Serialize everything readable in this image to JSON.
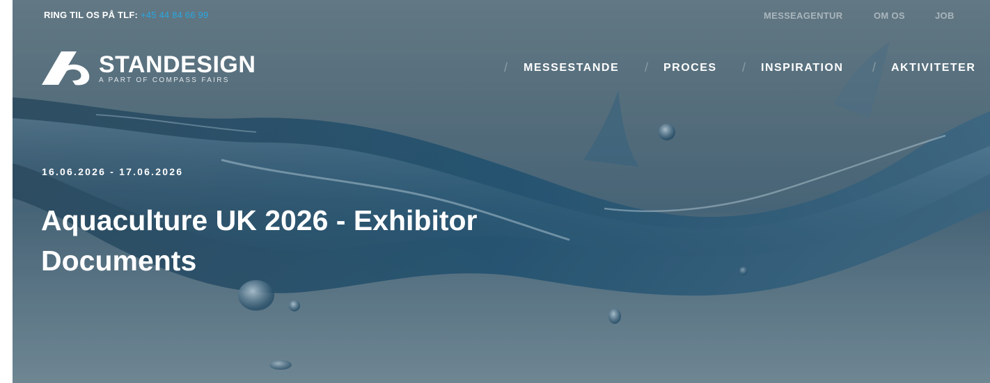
{
  "topbar": {
    "phone_label": "RING TIL OS PÅ TLF:",
    "phone_number": "+45 44 84 66 99",
    "links": [
      "MESSEAGENTUR",
      "OM OS",
      "JOB"
    ]
  },
  "logo": {
    "name": "STANDESIGN",
    "tagline": "A PART OF COMPASS FAIRS"
  },
  "nav": {
    "items": [
      "MESSESTANDE",
      "PROCES",
      "INSPIRATION",
      "AKTIVITETER"
    ],
    "separator": "/"
  },
  "hero": {
    "date": "16.06.2026 - 17.06.2026",
    "title": "Aquaculture UK 2026 - Exhibitor Documents",
    "background_icon": "water-splash-image"
  },
  "colors": {
    "accent": "#2aa7e0",
    "text": "#ffffff",
    "muted_link": "#aab6bd"
  }
}
